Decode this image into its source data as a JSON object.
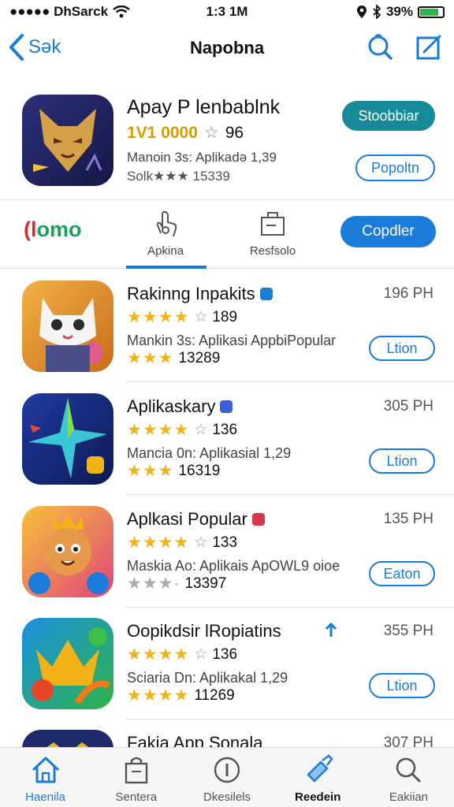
{
  "status_bar": {
    "carrier": "●●●●● DhSarck",
    "time": "1:3 1M",
    "battery_percent": "39%",
    "battery_level": 0.82
  },
  "nav": {
    "back_label": "Sək",
    "title": "Napobna"
  },
  "featured": {
    "name": "Apay P lenbablnk",
    "rating_count": "1V1 0000",
    "rating_small": "96",
    "meta": "Manoin 3s: Aplikadə 1,39",
    "meta2": "Solk★★★ 15339",
    "primary_button": "Stoobbiar",
    "secondary_button": "Popoltn"
  },
  "tabs": {
    "brand_part1": "(l",
    "brand_part2": "omo",
    "tab1_label": "Apkina",
    "tab2_label": "Resfsolo",
    "action_button": "Copdler"
  },
  "apps": [
    {
      "name": "Rakinng Inpakits",
      "size": "196 PH",
      "stars": "★★★★",
      "rating": "189",
      "desc": "Mankin 3s: Aplikasi AppbiPopular",
      "stars2": "★★★",
      "rating2": "13289",
      "button": "Ltion",
      "badge_color": "#1a7bd8"
    },
    {
      "name": "Aplikaskary",
      "size": "305 PH",
      "stars": "★★★★",
      "rating": "136",
      "desc": "Mancia 0n: Aplikasial 1,29",
      "stars2": "★★★",
      "rating2": "16319",
      "button": "Ltion",
      "badge_color": "#3a5fd8"
    },
    {
      "name": "Aplkasi Popular",
      "size": "135 PH",
      "stars": "★★★★",
      "rating": "133",
      "desc": "Maskia Ao: Aplikais ApOWL9 oioe",
      "stars2": "★★★·",
      "rating2": "13397",
      "button": "Eaton",
      "badge_color": "#d8344a"
    },
    {
      "name": "Oopikdsir lRopiatins",
      "size": "355 PH",
      "stars": "★★★★",
      "rating": "136",
      "desc": "Sciaria Dn: Aplikakal 1,29",
      "stars2": "★★★★",
      "rating2": "11269",
      "button": "Ltion",
      "badge_color": "#1a7bd8"
    },
    {
      "name": "Fakia App Sonala",
      "size": "307 PH"
    }
  ],
  "tabbar": [
    {
      "label": "Haenila"
    },
    {
      "label": "Sentera"
    },
    {
      "label": "Dkesilels"
    },
    {
      "label": "Reedein"
    },
    {
      "label": "Eakiian"
    }
  ],
  "colors": {
    "accent": "#1a7bd8",
    "teal": "#168a98",
    "star": "#f2b318"
  }
}
